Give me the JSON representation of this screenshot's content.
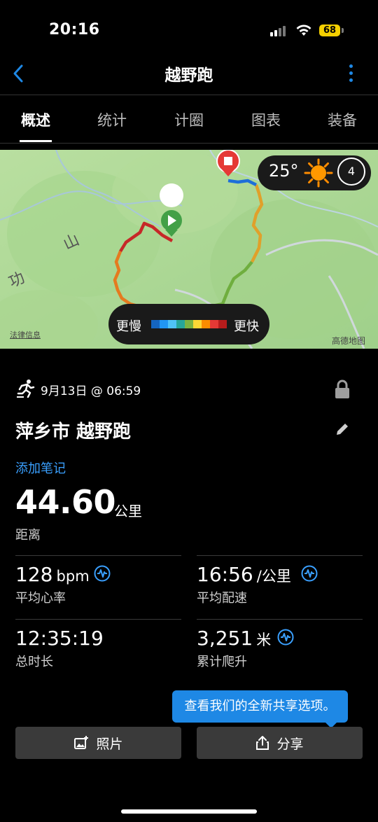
{
  "status": {
    "time": "20:16",
    "battery": "68"
  },
  "nav": {
    "title": "越野跑"
  },
  "tabs": [
    "概述",
    "统计",
    "计圈",
    "图表",
    "装备"
  ],
  "map": {
    "place_labels": [
      "山",
      "功"
    ],
    "weather": {
      "temperature": "25°",
      "wind_level": "4",
      "icon": "sun-icon"
    },
    "pace_legend": {
      "slow": "更慢",
      "fast": "更快",
      "colors": [
        "#1565c0",
        "#2196f3",
        "#4fc3f7",
        "#26a69a",
        "#7cb342",
        "#fdd835",
        "#fb8c00",
        "#e53935",
        "#b71c1c"
      ]
    },
    "legal": "法律信息",
    "provider": "高德地图"
  },
  "activity": {
    "date": "9月13日 @ 06:59",
    "title": "萍乡市 越野跑",
    "add_note": "添加笔记",
    "distance_value": "44.60",
    "distance_unit": "公里",
    "distance_label": "距离"
  },
  "stats": {
    "heart_rate": {
      "value": "128",
      "unit": "bpm",
      "label": "平均心率"
    },
    "pace": {
      "value": "16:56",
      "unit": "/公里",
      "label": "平均配速"
    },
    "duration": {
      "value": "12:35:19",
      "label": "总时长"
    },
    "ascent": {
      "value": "3,251",
      "unit": "米",
      "label": "累计爬升"
    }
  },
  "tooltip": "查看我们的全新共享选项。",
  "buttons": {
    "photos": "照片",
    "share": "分享"
  },
  "colors": {
    "accent": "#1e88e5",
    "link": "#3aa0ff",
    "start": "#43a047",
    "stop": "#e53935"
  }
}
